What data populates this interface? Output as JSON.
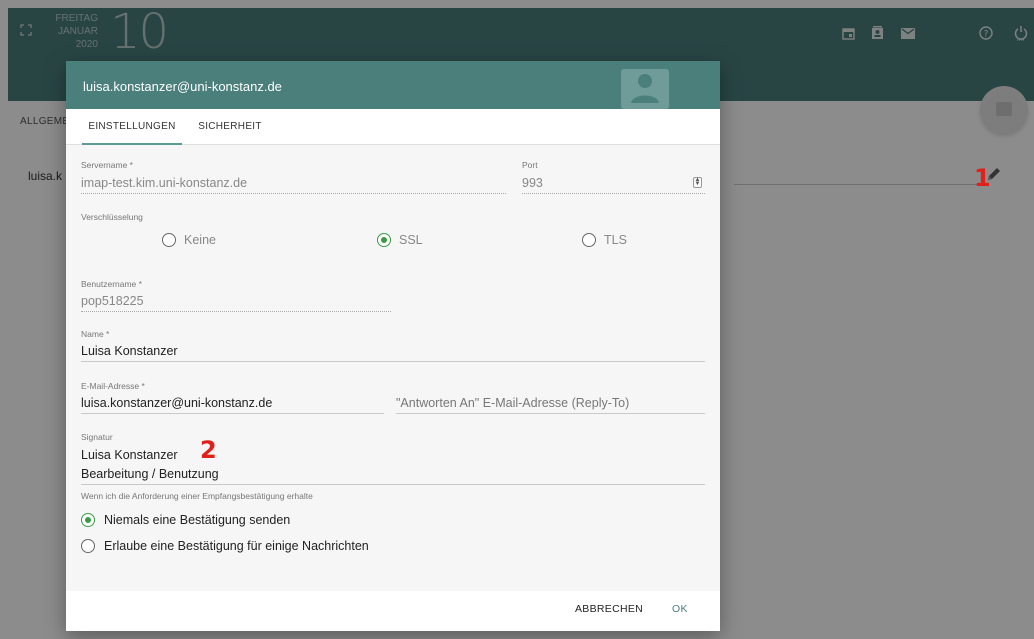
{
  "topbar": {
    "weekday": "FREITAG",
    "month": "JANUAR",
    "year": "2020",
    "day": "10",
    "icons": [
      "fullscreen-icon",
      "calendar-icon",
      "contacts-icon",
      "mail-icon",
      "help-icon",
      "power-icon"
    ]
  },
  "background": {
    "tab_label": "ALLGEMEI",
    "account_label": "luisa.k",
    "marker_1": "1"
  },
  "dialog": {
    "title": "luisa.konstanzer@uni-konstanz.de",
    "tabs": [
      {
        "label": "EINSTELLUNGEN",
        "active": true
      },
      {
        "label": "SICHERHEIT",
        "active": false
      }
    ],
    "servername": {
      "label": "Servername *",
      "value": "imap-test.kim.uni-konstanz.de"
    },
    "port": {
      "label": "Port",
      "value": "993"
    },
    "encryption": {
      "label": "Verschlüsselung",
      "options": [
        "Keine",
        "SSL",
        "TLS"
      ],
      "selected": "SSL"
    },
    "username": {
      "label": "Benutzername *",
      "value": "pop518225"
    },
    "name": {
      "label": "Name *",
      "value": "Luisa Konstanzer"
    },
    "email": {
      "label": "E-Mail-Adresse *",
      "value": "luisa.konstanzer@uni-konstanz.de"
    },
    "reply_to": {
      "placeholder": "\"Antworten An\" E-Mail-Adresse (Reply-To)"
    },
    "signature": {
      "label": "Signatur",
      "line1": "Luisa Konstanzer",
      "line2": "Bearbeitung / Benutzung"
    },
    "marker_2": "2",
    "receipt": {
      "label": "Wenn ich die Anforderung einer Empfangsbestätigung erhalte",
      "options": [
        "Niemals eine Bestätigung senden",
        "Erlaube eine Bestätigung für einige Nachrichten"
      ],
      "selected": "Niemals eine Bestätigung senden"
    },
    "buttons": {
      "cancel": "ABBRECHEN",
      "ok": "OK"
    }
  },
  "colors": {
    "header": "#4a7f7c",
    "accent": "#3a9a45",
    "marker": "#e0201b"
  }
}
